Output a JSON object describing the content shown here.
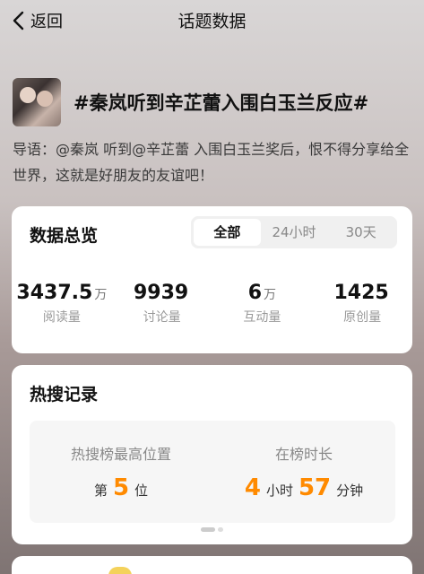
{
  "header": {
    "back_label": "返回",
    "title": "话题数据"
  },
  "topic": {
    "name": "#秦岚听到辛芷蕾入围白玉兰反应#",
    "guide": "导语：@秦岚 听到@辛芷蕾 入围白玉兰奖后，恨不得分享给全世界，这就是好朋友的友谊吧！"
  },
  "overview": {
    "title": "数据总览",
    "tabs": [
      {
        "label": "全部",
        "active": true
      },
      {
        "label": "24小时",
        "active": false
      },
      {
        "label": "30天",
        "active": false
      }
    ],
    "stats": [
      {
        "value": "3437.5",
        "unit": "万",
        "label": "阅读量"
      },
      {
        "value": "9939",
        "unit": "",
        "label": "讨论量"
      },
      {
        "value": "6",
        "unit": "万",
        "label": "互动量"
      },
      {
        "value": "1425",
        "unit": "",
        "label": "原创量"
      }
    ]
  },
  "hot_search": {
    "title": "热搜记录",
    "highest": {
      "label": "热搜榜最高位置",
      "prefix": "第",
      "value": "5",
      "suffix": "位"
    },
    "duration": {
      "label": "在榜时长",
      "hours": "4",
      "hours_unit": "小时",
      "minutes": "57",
      "minutes_unit": "分钟"
    }
  },
  "colors": {
    "accent": "#ff8a00",
    "card": "#ffffff"
  }
}
